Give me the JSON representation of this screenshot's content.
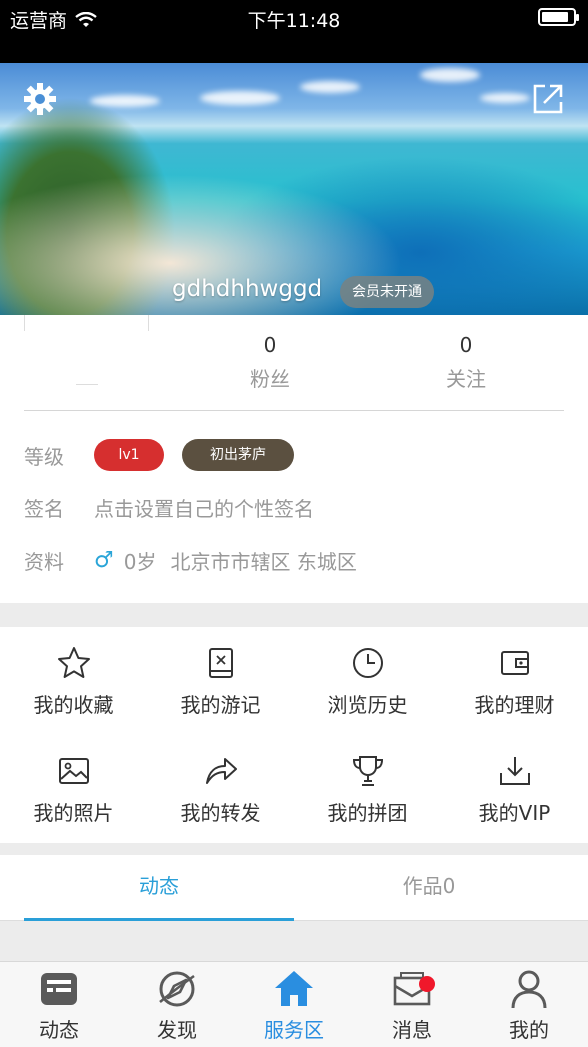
{
  "status_bar": {
    "carrier": "运营商",
    "time": "下午11:48"
  },
  "profile": {
    "username": "gdhdhhwggd",
    "vip_status": "会员未开通"
  },
  "stats": [
    {
      "count": "0",
      "label": "粉丝"
    },
    {
      "count": "0",
      "label": "关注"
    }
  ],
  "info": {
    "level_key": "等级",
    "level_badge": "lv1",
    "title_badge": "初出茅庐",
    "signature_key": "签名",
    "signature_value": "点击设置自己的个性签名",
    "profile_key": "资料",
    "gender_icon": "♂",
    "age": "0岁",
    "location": "北京市市辖区 东城区"
  },
  "services": [
    {
      "label": "我的收藏",
      "icon": "star-icon"
    },
    {
      "label": "我的游记",
      "icon": "book-icon"
    },
    {
      "label": "浏览历史",
      "icon": "clock-icon"
    },
    {
      "label": "我的理财",
      "icon": "wallet-icon"
    },
    {
      "label": "我的照片",
      "icon": "image-icon"
    },
    {
      "label": "我的转发",
      "icon": "share-arrow-icon"
    },
    {
      "label": "我的拼团",
      "icon": "trophy-icon"
    },
    {
      "label": "我的VIP",
      "icon": "download-icon"
    }
  ],
  "tabs": [
    {
      "label": "动态",
      "active": true
    },
    {
      "label": "作品0",
      "active": false
    }
  ],
  "bottom_nav": [
    {
      "label": "动态",
      "icon": "feed-icon"
    },
    {
      "label": "发现",
      "icon": "compass-icon"
    },
    {
      "label": "服务区",
      "icon": "home-icon",
      "active": true
    },
    {
      "label": "消息",
      "icon": "mail-icon",
      "badge_dot": true
    },
    {
      "label": "我的",
      "icon": "person-icon"
    }
  ],
  "colors": {
    "accent": "#2a9fd8",
    "level_badge": "#d62f2f",
    "title_badge": "#5b5040",
    "notification_dot": "#f0182b"
  }
}
